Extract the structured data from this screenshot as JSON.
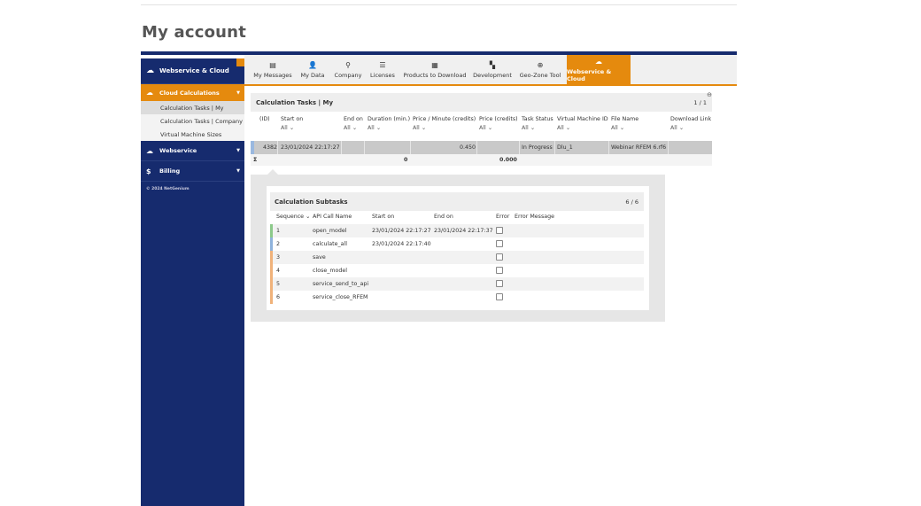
{
  "page": {
    "title": "My account"
  },
  "sidebar": {
    "main": {
      "label": "Webservice & Cloud"
    },
    "cloud": {
      "label": "Cloud Calculations"
    },
    "sub_items": [
      "Calculation Tasks | My",
      "Calculation Tasks | Company",
      "Virtual Machine Sizes"
    ],
    "webservice": {
      "label": "Webservice"
    },
    "billing": {
      "label": "Billing"
    },
    "copyright": "© 2024 NetGenium"
  },
  "tabs": [
    "My Messages",
    "My Data",
    "Company",
    "Licenses",
    "Products to Download",
    "Development",
    "Geo-Zone Tool",
    "Webservice & Cloud"
  ],
  "tasks": {
    "title": "Calculation Tasks | My",
    "count": "1 / 1",
    "columns": [
      "(ID)",
      "Start on",
      "End on",
      "Duration (min.)",
      "Price / Minute (credits)",
      "Price (credits)",
      "Task Status",
      "Virtual Machine ID",
      "File Name",
      "Download Link"
    ],
    "filter": "All",
    "row": {
      "id": "4382",
      "start": "23/01/2024 22:17:27",
      "price_minute": "0.450",
      "status": "In Progress",
      "vm": "Dlu_1",
      "file": "Webinar RFEM 6.rf6"
    },
    "sum": {
      "symbol": "Σ",
      "duration": "0",
      "price": "0.000"
    }
  },
  "subtasks": {
    "title": "Calculation Subtasks",
    "count": "6 / 6",
    "columns": [
      "Sequence",
      "API Call Name",
      "Start on",
      "End on",
      "Error",
      "Error Message"
    ],
    "rows": [
      {
        "seq": "1",
        "name": "open_model",
        "start": "23/01/2024 22:17:27",
        "end": "23/01/2024 22:17:37"
      },
      {
        "seq": "2",
        "name": "calculate_all",
        "start": "23/01/2024 22:17:40",
        "end": ""
      },
      {
        "seq": "3",
        "name": "save",
        "start": "",
        "end": ""
      },
      {
        "seq": "4",
        "name": "close_model",
        "start": "",
        "end": ""
      },
      {
        "seq": "5",
        "name": "service_send_to_api",
        "start": "",
        "end": ""
      },
      {
        "seq": "6",
        "name": "service_close_RFEM",
        "start": "",
        "end": ""
      }
    ]
  },
  "colors": {
    "navy": "#162b6e",
    "orange": "#e58a0e",
    "done": "#8cc98a",
    "running": "#8fb3dc",
    "pending": "#f0b27a"
  }
}
